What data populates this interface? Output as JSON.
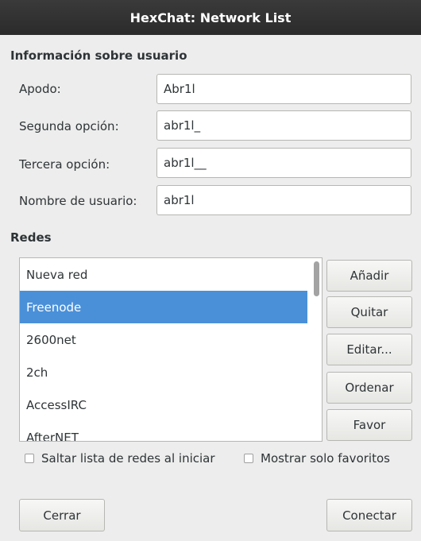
{
  "window": {
    "title": "HexChat: Network List"
  },
  "user_info": {
    "heading": "Información sobre usuario",
    "fields": [
      {
        "label": "Apodo:",
        "value": "Abr1l"
      },
      {
        "label": "Segunda opción:",
        "value": "abr1l_"
      },
      {
        "label": "Tercera opción:",
        "value": "abr1l__"
      },
      {
        "label": "Nombre de usuario:",
        "value": "abr1l"
      }
    ]
  },
  "networks": {
    "heading": "Redes",
    "items": [
      "Nueva red",
      "Freenode",
      "2600net",
      "2ch",
      "AccessIRC",
      "AfterNET"
    ],
    "selected": "Freenode",
    "buttons": {
      "add": "Añadir",
      "remove": "Quitar",
      "edit": "Editar...",
      "sort": "Ordenar",
      "favor": "Favor"
    }
  },
  "options": {
    "skip_list": {
      "label": "Saltar lista de redes al iniciar",
      "checked": false
    },
    "favorites_only": {
      "label": "Mostrar solo favoritos",
      "checked": false
    }
  },
  "footer": {
    "close": "Cerrar",
    "connect": "Conectar"
  },
  "colors": {
    "selection": "#4a90d9",
    "titlebar": "#2f2f2f",
    "background": "#ededed"
  }
}
